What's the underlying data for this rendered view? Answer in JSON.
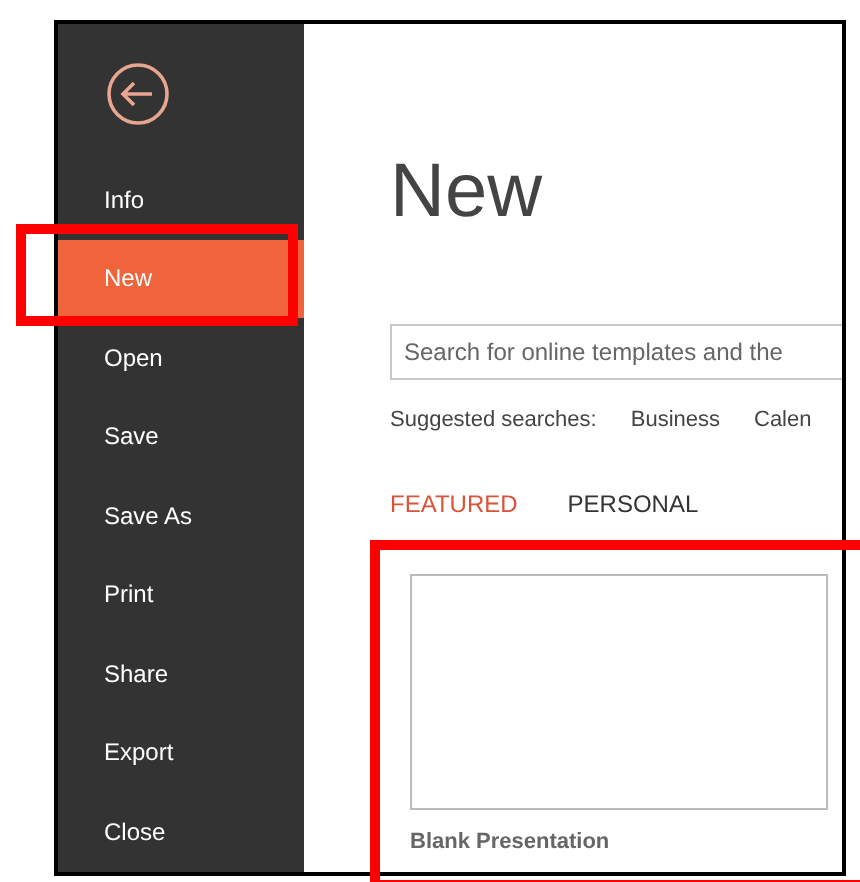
{
  "sidebar": {
    "items": [
      {
        "label": "Info",
        "selected": false
      },
      {
        "label": "New",
        "selected": true
      },
      {
        "label": "Open",
        "selected": false
      },
      {
        "label": "Save",
        "selected": false
      },
      {
        "label": "Save As",
        "selected": false
      },
      {
        "label": "Print",
        "selected": false
      },
      {
        "label": "Share",
        "selected": false
      },
      {
        "label": "Export",
        "selected": false
      },
      {
        "label": "Close",
        "selected": false
      }
    ]
  },
  "title": "New",
  "search": {
    "placeholder": "Search for online templates and the"
  },
  "suggested": {
    "label": "Suggested searches:",
    "items": [
      "Business",
      "Calen"
    ]
  },
  "tabs": [
    {
      "label": "FEATURED",
      "selected": true
    },
    {
      "label": "PERSONAL",
      "selected": false
    }
  ],
  "templates": [
    {
      "label": "Blank Presentation"
    }
  ]
}
